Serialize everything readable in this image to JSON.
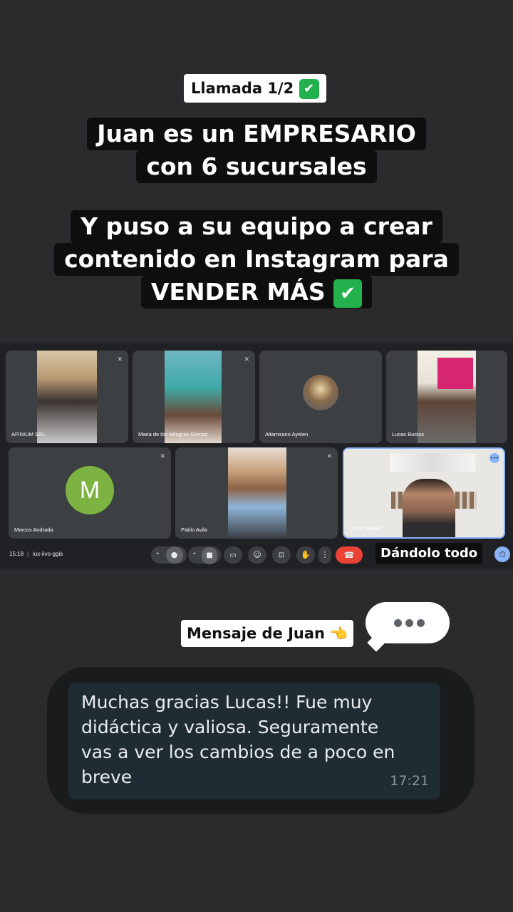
{
  "header": {
    "call_label": "Llamada 1/2",
    "headline_1": [
      "Juan es un EMPRESARIO",
      "con 6 sucursales"
    ],
    "headline_2": [
      "Y puso a su equipo a crear",
      "contenido en Instagram para",
      "VENDER MÁS"
    ],
    "check_glyph": "✔"
  },
  "meet": {
    "participants": [
      {
        "name": "AFINIUM SRL"
      },
      {
        "name": "Maria de los Milagros Gomez"
      },
      {
        "name": "Altamirano Ayelen"
      },
      {
        "name": "Lucas Bustos"
      },
      {
        "name": "Marcos Andrada",
        "initial": "M"
      },
      {
        "name": "Pablo Avila"
      },
      {
        "name": "Lucas Welter"
      }
    ],
    "time": "15:18",
    "meeting_code": "iux-iivo-ggis",
    "caption": "Dándolo todo",
    "accent": "#8ab4f8",
    "end_call_color": "#ea4335",
    "avatar_color": "#7cb342"
  },
  "message": {
    "label": "Mensaje de Juan",
    "label_emoji": "👈",
    "text_lines": [
      "Muchas gracias Lucas!! Fue muy",
      "didáctica y valiosa. Seguramente",
      "vas a ver los cambios de a poco en",
      "breve"
    ],
    "time": "17:21"
  }
}
